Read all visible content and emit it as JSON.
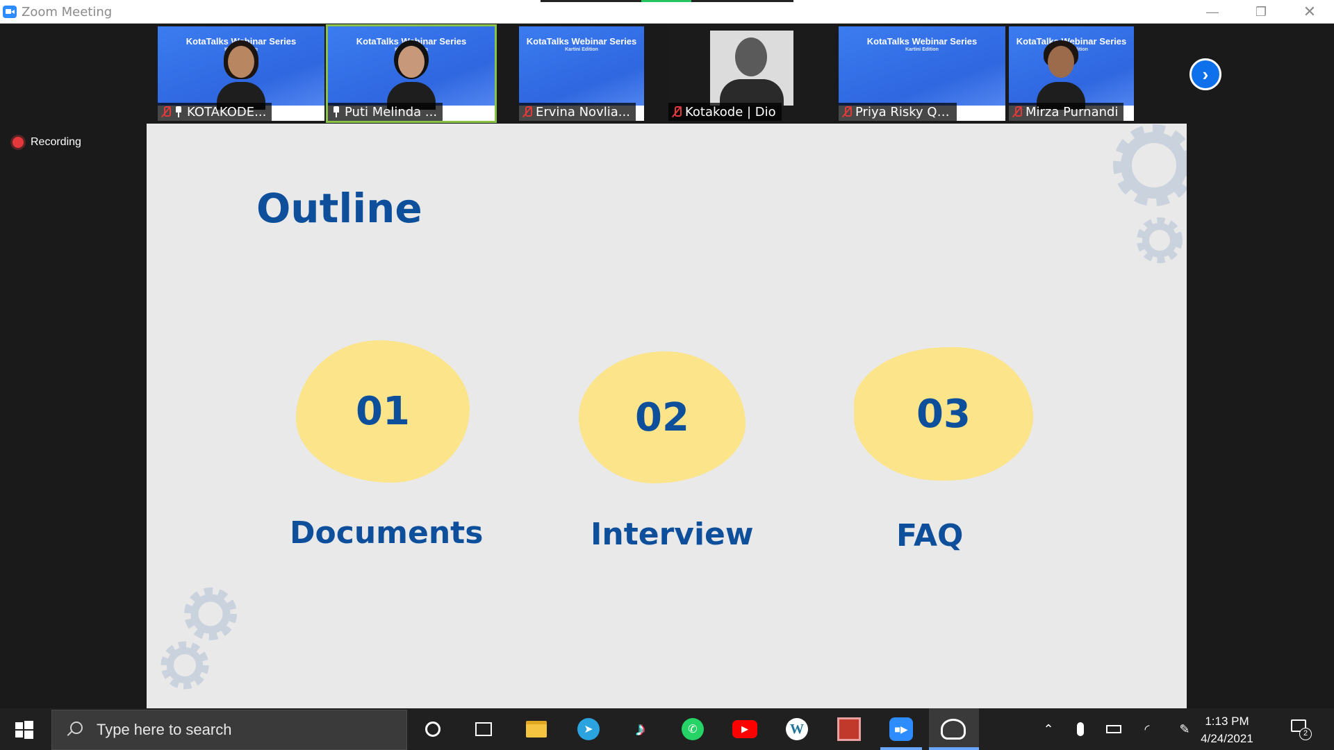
{
  "window": {
    "title": "Zoom Meeting"
  },
  "participants": [
    {
      "name": "KOTAKODE...",
      "series": "KotaTalks Webinar Series",
      "edition": "Kartini Edition",
      "muted": true,
      "pinned": true
    },
    {
      "name": "Puti Melinda ...",
      "series": "KotaTalks Webinar Series",
      "edition": "Kartini Edition",
      "muted": false,
      "pinned": true,
      "active_speaker": true
    },
    {
      "name": "Ervina Novlia...",
      "series": "KotaTalks Webinar Series",
      "edition": "Kartini Edition",
      "muted": true
    },
    {
      "name": "Kotakode | Dio",
      "muted": true
    },
    {
      "name": "Priya Risky Qu...",
      "series": "KotaTalks Webinar Series",
      "edition": "Kartini Edition",
      "muted": true
    },
    {
      "name": "Mirza Purnandi",
      "series": "KotaTalks Webinar Series",
      "edition": "Kartini Edition",
      "muted": true
    }
  ],
  "recording": {
    "label": "Recording",
    "color": "#e5383b"
  },
  "slide": {
    "title": "Outline",
    "items": [
      {
        "number": "01",
        "label": "Documents"
      },
      {
        "number": "02",
        "label": "Interview"
      },
      {
        "number": "03",
        "label": "FAQ"
      }
    ],
    "colors": {
      "text": "#0d4f9a",
      "blob": "#fbe48a",
      "background": "#e9e9ea",
      "gear": "#c9d2dd"
    }
  },
  "taskbar": {
    "search_placeholder": "Type here to search",
    "apps": [
      "cortana-icon",
      "task-view-icon",
      "file-explorer-icon",
      "telegram-icon",
      "tiktok-icon",
      "whatsapp-icon",
      "youtube-icon",
      "wordpress-icon",
      "calculator-app-icon",
      "zoom-icon",
      "photos-icon"
    ],
    "clock": {
      "time": "1:13 PM",
      "date": "4/24/2021"
    },
    "notification_count": "2"
  }
}
